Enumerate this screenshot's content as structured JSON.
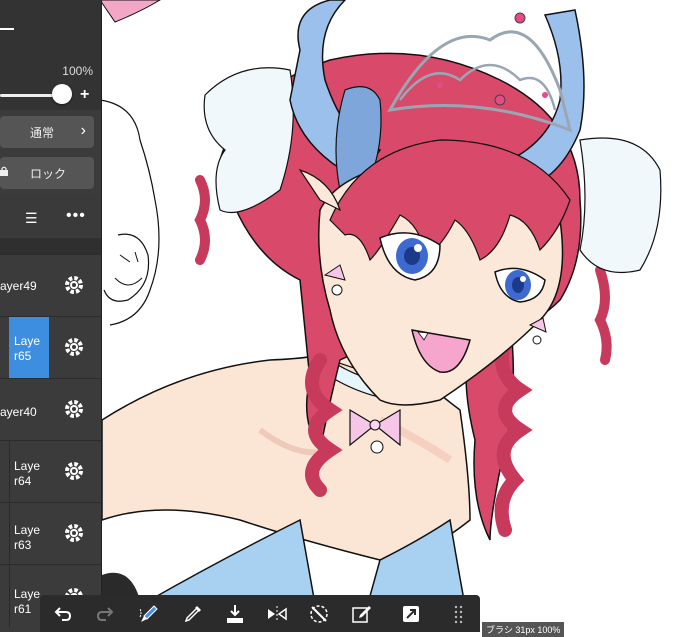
{
  "panel": {
    "opacity_value": "100%",
    "blend_mode": "通常",
    "lock_label": "ロック"
  },
  "layers": [
    {
      "label": "ayer49",
      "selected": false
    },
    {
      "label": "Laye\nr65",
      "selected": true
    },
    {
      "label": "ayer40",
      "selected": false
    },
    {
      "label": "Laye\nr64",
      "selected": false
    },
    {
      "label": "Laye\nr63",
      "selected": false
    },
    {
      "label": "Laye\nr61",
      "selected": false
    }
  ],
  "status": {
    "text": "ブラシ 31px 100%"
  },
  "icons": {
    "toolbar": [
      "undo-icon",
      "redo-icon",
      "eraser-brush-icon",
      "eyedropper-icon",
      "fill-icon",
      "flip-horizontal-icon",
      "rotate-cancel-icon",
      "edit-icon",
      "transform-icon",
      "grid-icon"
    ]
  },
  "colors": {
    "selected_layer": "#3d8ee0",
    "panel_bg": "#3b3b3b"
  }
}
